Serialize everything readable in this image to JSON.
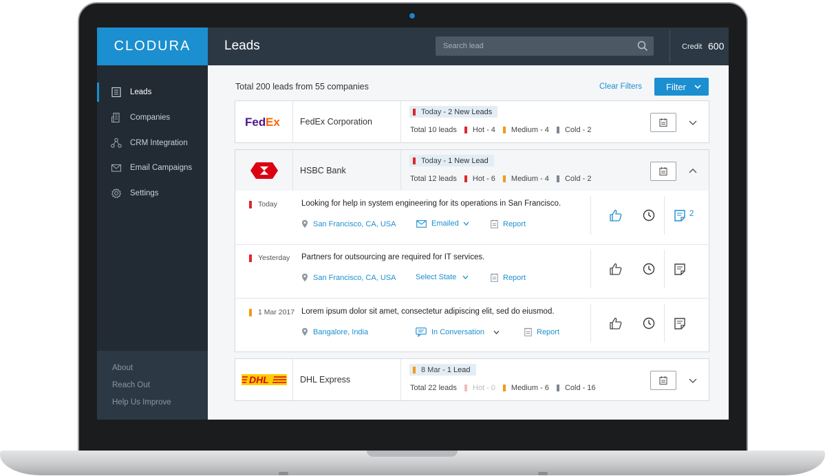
{
  "brand": "CLODURA",
  "header": {
    "title": "Leads",
    "search_placeholder": "Search lead",
    "credit_label": "Credit",
    "credit_value": "600"
  },
  "sidebar": {
    "items": [
      {
        "label": "Leads",
        "icon": "list-icon",
        "active": true
      },
      {
        "label": "Companies",
        "icon": "building-icon"
      },
      {
        "label": "CRM Integration",
        "icon": "network-icon"
      },
      {
        "label": "Email Campaigns",
        "icon": "mail-icon"
      },
      {
        "label": "Settings",
        "icon": "gear-icon"
      }
    ],
    "footer": [
      "About",
      "Reach Out",
      "Help Us Improve"
    ]
  },
  "main": {
    "summary": "Total 200 leads from 55 companies",
    "clear_filters": "Clear Filters",
    "filter_label": "Filter"
  },
  "companies": [
    {
      "name": "FedEx Corporation",
      "logo": "fedex-logo",
      "tag_day": "Today -",
      "tag_count": "2 New Leads",
      "tag_color": "#e0262a",
      "total": "Total 10 leads",
      "hot": "Hot - 4",
      "medium": "Medium - 4",
      "cold": "Cold - 2"
    },
    {
      "name": "HSBC Bank",
      "logo": "hsbc-logo",
      "tag_day": "Today -",
      "tag_count": "1 New Lead",
      "tag_color": "#e0262a",
      "total": "Total 12 leads",
      "hot": "Hot - 6",
      "medium": "Medium - 4",
      "cold": "Cold - 2",
      "expanded": true
    },
    {
      "name": "DHL Express",
      "logo": "dhl-logo",
      "tag_day": "8 Mar -",
      "tag_count": "1 Lead",
      "tag_color": "#f39a16",
      "total": "Total 22 leads",
      "hot": "Hot - 0",
      "medium": "Medium - 6",
      "cold": "Cold - 16"
    }
  ],
  "leads": [
    {
      "age": "Today",
      "age_color": "#e0262a",
      "text": "Looking for help in system engineering for its operations in San Francisco.",
      "location": "San Francisco, CA, USA",
      "status": "Emailed",
      "report": "Report",
      "notes_count": "2",
      "liked": true
    },
    {
      "age": "Yesterday",
      "age_color": "#e0262a",
      "text": "Partners for outsourcing are required for IT services.",
      "location": "San Francisco, CA, USA",
      "status": "Select State",
      "report": "Report"
    },
    {
      "age": "1 Mar 2017",
      "age_color": "#f39a16",
      "text": "Lorem ipsum dolor sit amet, consectetur adipiscing elit, sed do eiusmod.",
      "location": "Bangalore, India",
      "status": "In Conversation",
      "report": "Report"
    }
  ],
  "colors": {
    "accent": "#1b8fcf",
    "hot": "#e0262a",
    "medium": "#f39a16",
    "cold": "#7d8790",
    "topbar": "#2c3844",
    "sidebar": "#222b34"
  }
}
